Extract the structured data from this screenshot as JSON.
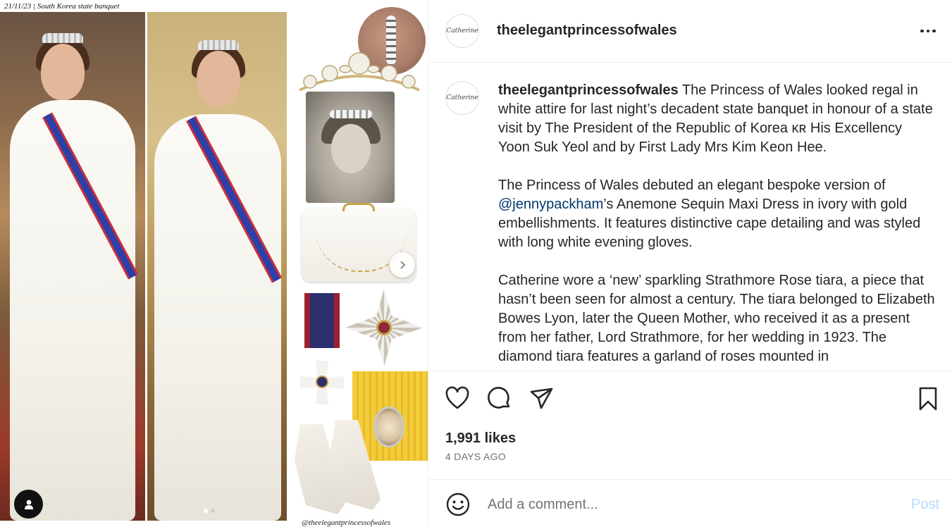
{
  "media": {
    "top_caption": "21/11/23 | South Korea state banquet",
    "watermark": "@theelegantprincessofwales",
    "carousel_dots": 2,
    "active_dot": 0
  },
  "post": {
    "username": "theelegantprincessofwales",
    "avatar_text": "Catherine",
    "caption": {
      "username": "theelegantprincessofwales",
      "paragraph1": " The Princess of Wales looked regal in white attire for last night’s decadent state banquet in honour of a state visit by The President of the Republic of Korea ᴋʀ His Excellency Yoon Suk Yeol and by First Lady Mrs Kim Keon Hee.",
      "paragraph2_before": "The Princess of Wales debuted an elegant bespoke version of ",
      "paragraph2_mention": "@jennypackham",
      "paragraph2_after": "’s Anemone Sequin Maxi Dress in ivory with gold embellishments. It features distinctive cape detailing and was styled with long white evening gloves.",
      "paragraph3": "Catherine wore a ‘new’ sparkling Strathmore Rose tiara, a piece that hasn’t been seen for almost a century. The tiara belonged to Elizabeth Bowes Lyon, later the Queen Mother, who received it as a present from her father, Lord Strathmore, for her wedding in 1923. The diamond tiara features a garland of roses mounted in"
    },
    "likes": "1,991 likes",
    "time_ago": "4 days ago"
  },
  "composer": {
    "placeholder": "Add a comment...",
    "post_label": "Post"
  },
  "colors": {
    "text": "#262626",
    "secondary": "#737373",
    "link": "#00376b",
    "post_disabled": "#b3dbff",
    "divider": "#efefef"
  },
  "icons": {
    "more": "more-icon",
    "like": "heart-icon",
    "comment": "comment-icon",
    "share": "share-icon",
    "save": "bookmark-icon",
    "emoji": "emoji-icon",
    "next": "chevron-right-icon",
    "tagged_user": "user-icon"
  }
}
